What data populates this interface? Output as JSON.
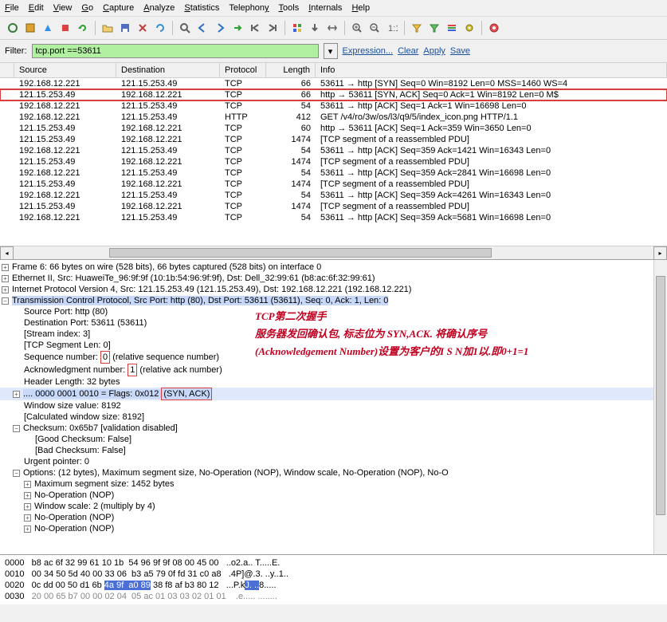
{
  "menu": [
    "File",
    "Edit",
    "View",
    "Go",
    "Capture",
    "Analyze",
    "Statistics",
    "Telephony",
    "Tools",
    "Internals",
    "Help"
  ],
  "toolbar_icons": [
    "interfaces",
    "options",
    "start",
    "stop",
    "restart",
    "open",
    "save",
    "close",
    "reload",
    "find",
    "back",
    "fwd",
    "jump",
    "first",
    "last",
    "colorize",
    "auto",
    "resize",
    "cols",
    "zoom-in",
    "zoom-out",
    "normal",
    "filter1",
    "filter2",
    "filter3",
    "prefs",
    "help"
  ],
  "filter": {
    "label": "Filter:",
    "value": "tcp.port ==53611",
    "btn_expr": "Expression...",
    "btn_clear": "Clear",
    "btn_apply": "Apply",
    "btn_save": "Save"
  },
  "columns": [
    "Source",
    "Destination",
    "Protocol",
    "Length",
    "Info"
  ],
  "rows": [
    {
      "src": "192.168.12.221",
      "dst": "121.15.253.49",
      "proto": "TCP",
      "len": "66",
      "info": "53611 → http [SYN] Seq=0 Win=8192 Len=0 MSS=1460 WS=4"
    },
    {
      "src": "121.15.253.49",
      "dst": "192.168.12.221",
      "proto": "TCP",
      "len": "66",
      "info": "http → 53611 [SYN, ACK] Seq=0 Ack=1 Win=8192 Len=0 M$"
    },
    {
      "src": "192.168.12.221",
      "dst": "121.15.253.49",
      "proto": "TCP",
      "len": "54",
      "info": "53611 → http [ACK] Seq=1 Ack=1 Win=16698 Len=0"
    },
    {
      "src": "192.168.12.221",
      "dst": "121.15.253.49",
      "proto": "HTTP",
      "len": "412",
      "info": "GET /v4/ro/3w/os/l3/q9/5/index_icon.png HTTP/1.1"
    },
    {
      "src": "121.15.253.49",
      "dst": "192.168.12.221",
      "proto": "TCP",
      "len": "60",
      "info": "http → 53611 [ACK] Seq=1 Ack=359 Win=3650 Len=0"
    },
    {
      "src": "121.15.253.49",
      "dst": "192.168.12.221",
      "proto": "TCP",
      "len": "1474",
      "info": "[TCP segment of a reassembled PDU]"
    },
    {
      "src": "192.168.12.221",
      "dst": "121.15.253.49",
      "proto": "TCP",
      "len": "54",
      "info": "53611 → http [ACK] Seq=359 Ack=1421 Win=16343 Len=0"
    },
    {
      "src": "121.15.253.49",
      "dst": "192.168.12.221",
      "proto": "TCP",
      "len": "1474",
      "info": "[TCP segment of a reassembled PDU]"
    },
    {
      "src": "192.168.12.221",
      "dst": "121.15.253.49",
      "proto": "TCP",
      "len": "54",
      "info": "53611 → http [ACK] Seq=359 Ack=2841 Win=16698 Len=0"
    },
    {
      "src": "121.15.253.49",
      "dst": "192.168.12.221",
      "proto": "TCP",
      "len": "1474",
      "info": "[TCP segment of a reassembled PDU]"
    },
    {
      "src": "192.168.12.221",
      "dst": "121.15.253.49",
      "proto": "TCP",
      "len": "54",
      "info": "53611 → http [ACK] Seq=359 Ack=4261 Win=16343 Len=0"
    },
    {
      "src": "121.15.253.49",
      "dst": "192.168.12.221",
      "proto": "TCP",
      "len": "1474",
      "info": "[TCP segment of a reassembled PDU]"
    },
    {
      "src": "192.168.12.221",
      "dst": "121.15.253.49",
      "proto": "TCP",
      "len": "54",
      "info": "53611 → http [ACK] Seq=359 Ack=5681 Win=16698 Len=0"
    }
  ],
  "tree": {
    "frame": "Frame 6: 66 bytes on wire (528 bits), 66 bytes captured (528 bits) on interface 0",
    "eth": "Ethernet II, Src: HuaweiTe_96:9f:9f (10:1b:54:96:9f:9f), Dst: Dell_32:99:61 (b8:ac:6f:32:99:61)",
    "ip": "Internet Protocol Version 4, Src: 121.15.253.49 (121.15.253.49), Dst: 192.168.12.221 (192.168.12.221)",
    "tcp": "Transmission Control Protocol, Src Port: http (80), Dst Port: 53611 (53611), Seq: 0, Ack: 1, Len: 0",
    "srcport": "Source Port: http (80)",
    "dstport": "Destination Port: 53611 (53611)",
    "stream": "[Stream index: 3]",
    "seglen": "[TCP Segment Len: 0]",
    "seqnum_pre": "Sequence number: ",
    "seqnum_val": "0",
    "seqnum_post": "   (relative sequence number)",
    "acknum_pre": "Acknowledgment number: ",
    "acknum_val": "1",
    "acknum_post": "   (relative ack number)",
    "hdrlen": "Header Length: 32 bytes",
    "flags_pre": ".... 0000 0001 0010 = Flags: 0x012 ",
    "flags_val": "(SYN, ACK)",
    "winsize": "Window size value: 8192",
    "calcwin": "[Calculated window size: 8192]",
    "checksum": "Checksum: 0x65b7 [validation disabled]",
    "goodck": "[Good Checksum: False]",
    "badck": "[Bad Checksum: False]",
    "urgent": "Urgent pointer: 0",
    "options": "Options: (12 bytes), Maximum segment size, No-Operation (NOP), Window scale, No-Operation (NOP), No-O",
    "mss": "Maximum segment size: 1452 bytes",
    "nop1": "No-Operation (NOP)",
    "wscale": "Window scale: 2 (multiply by 4)",
    "nop2": "No-Operation (NOP)",
    "nop3": "No-Operation (NOP)"
  },
  "annotations": {
    "a1": "TCP第二次握手",
    "a2": "服务器发回确认包, 标志位为 SYN,ACK. 将确认序号",
    "a3": "(Acknowledgement Number)设置为客户的I S N加1以.即0+1=1"
  },
  "hex": {
    "r0_off": "0000",
    "r0_hex": "b8 ac 6f 32 99 61 10 1b  54 96 9f 9f 08 00 45 00",
    "r0_asc": "..o2.a.. T.....E.",
    "r1_off": "0010",
    "r1_hex": "00 34 50 5d 40 00 33 06  b3 a5 79 0f fd 31 c0 a8",
    "r1_asc": ".4P]@.3. ..y..1..",
    "r2_off": "0020",
    "r2_hex": "0c dd 00 50 d1 6b ",
    "r2_hexsel": "4a 9f  a0 89",
    "r2_hex2": " 38 f8 af b3 80 12",
    "r2_asc_pre": "...P.k",
    "r2_asc_sel": "J. ..",
    "r2_asc_post": "8.....",
    "r3_off": "0030",
    "r3_hex": "20 00 65 b7 00 00 02 04  05 ac 01 03 03 02 01 01",
    "r3_asc": " .e..... ........"
  }
}
